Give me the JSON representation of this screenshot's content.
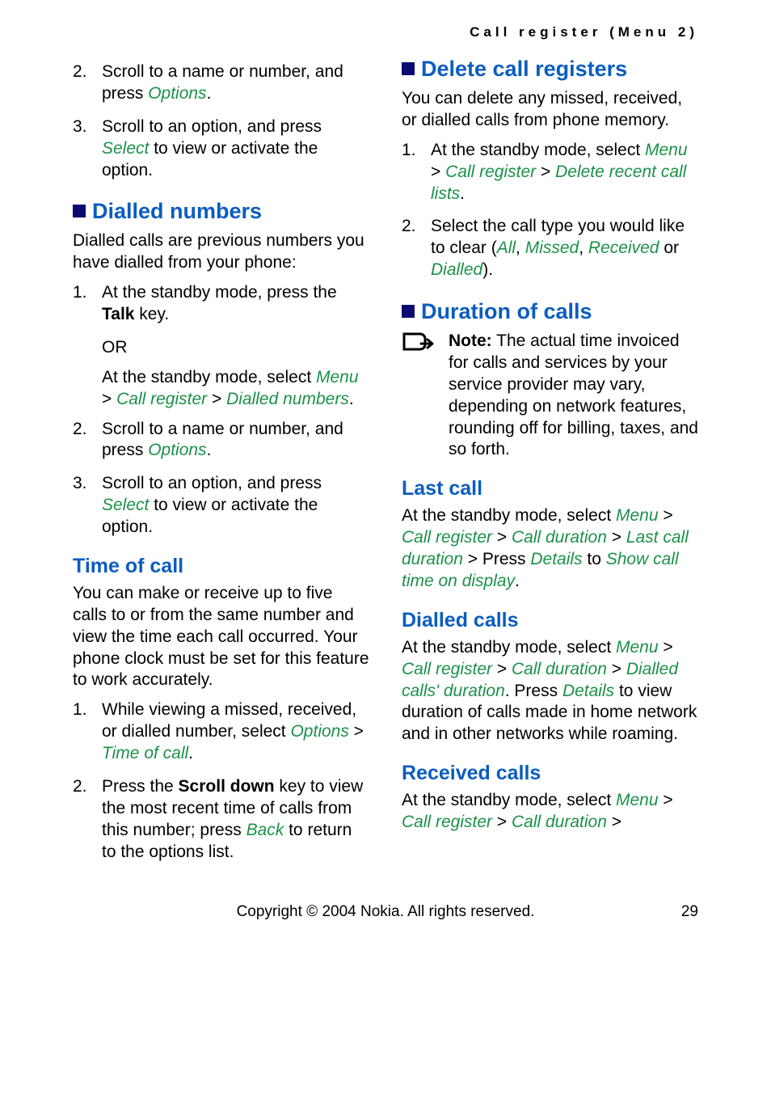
{
  "header": {
    "running": "Call register (Menu 2)"
  },
  "left": {
    "intro_steps": [
      {
        "n": "2.",
        "pre": "Scroll to a name or number, and press ",
        "opt": "Options",
        "post": "."
      },
      {
        "n": "3.",
        "pre": "Scroll to an option, and press ",
        "opt": "Select",
        "post": " to view or activate the option."
      }
    ],
    "dialled": {
      "title": "Dialled numbers",
      "intro": "Dialled calls are previous numbers you have dialled from your phone:",
      "step1": {
        "n": "1.",
        "pre": "At the standby mode, press the ",
        "bold": "Talk",
        "post": " key."
      },
      "or": "OR",
      "alt_pre": "At the standby mode, select ",
      "alt_parts": [
        "Menu",
        " > ",
        "Call register",
        " > ",
        "Dialled numbers",
        "."
      ],
      "step2": {
        "n": "2.",
        "pre": "Scroll to a name or number, and press ",
        "opt": "Options",
        "post": "."
      },
      "step3": {
        "n": "3.",
        "pre": "Scroll to an option, and press ",
        "opt": "Select",
        "post": " to view or activate the option."
      }
    },
    "time": {
      "title": "Time of call",
      "intro": "You can make or receive up to five calls to or from the same number and view the time each call occurred. Your phone clock must be set for this feature to work accurately.",
      "step1": {
        "n": "1.",
        "pre": "While viewing a missed, received, or dialled number, select ",
        "opt1": "Options",
        "mid": " > ",
        "opt2": "Time of call",
        "post": "."
      },
      "step2": {
        "n": "2.",
        "pre": "Press the ",
        "bold": "Scroll down",
        "mid": " key to view the most recent time of calls from this number; press ",
        "opt": "Back",
        "post": " to return to the options list."
      }
    }
  },
  "right": {
    "delete": {
      "title": "Delete call registers",
      "intro": "You can delete any missed, received, or dialled calls from phone memory.",
      "step1": {
        "n": "1.",
        "pre": "At the standby mode, select ",
        "parts": [
          "Menu",
          " > ",
          "Call register",
          " > ",
          "Delete recent call lists",
          "."
        ]
      },
      "step2": {
        "n": "2.",
        "pre": "Select the call type you would like to clear (",
        "opts": [
          "All",
          ", ",
          "Missed",
          ", ",
          "Received"
        ],
        "mid": " or ",
        "last": "Dialled",
        "post": ")."
      }
    },
    "duration": {
      "title": "Duration of calls",
      "note_label": "Note:",
      "note_body": " The actual time invoiced for calls and services by your service provider may vary, depending on network features, rounding off for billing, taxes, and so forth."
    },
    "last": {
      "title": "Last call",
      "pre": "At the standby mode, select ",
      "parts": [
        "Menu",
        " > ",
        "Call register",
        " > ",
        "Call duration",
        " > ",
        "Last call duration"
      ],
      "mid1": " > Press ",
      "details": "Details",
      "mid2": " to ",
      "show": "Show call time on display",
      "post": "."
    },
    "dialled_calls": {
      "title": "Dialled calls",
      "pre": "At the standby mode, select ",
      "parts": [
        "Menu",
        " > ",
        "Call register",
        " > ",
        "Call duration",
        " > ",
        "Dialled calls' duration"
      ],
      "mid1": ". Press ",
      "details": "Details",
      "post": " to view duration of calls made in home network and in other networks while roaming."
    },
    "received": {
      "title": "Received calls",
      "pre": "At the standby mode, select ",
      "parts": [
        "Menu",
        " > ",
        "Call register",
        " > ",
        "Call duration",
        " > "
      ]
    }
  },
  "footer": {
    "copyright": "Copyright © 2004 Nokia. All rights reserved.",
    "page": "29"
  }
}
